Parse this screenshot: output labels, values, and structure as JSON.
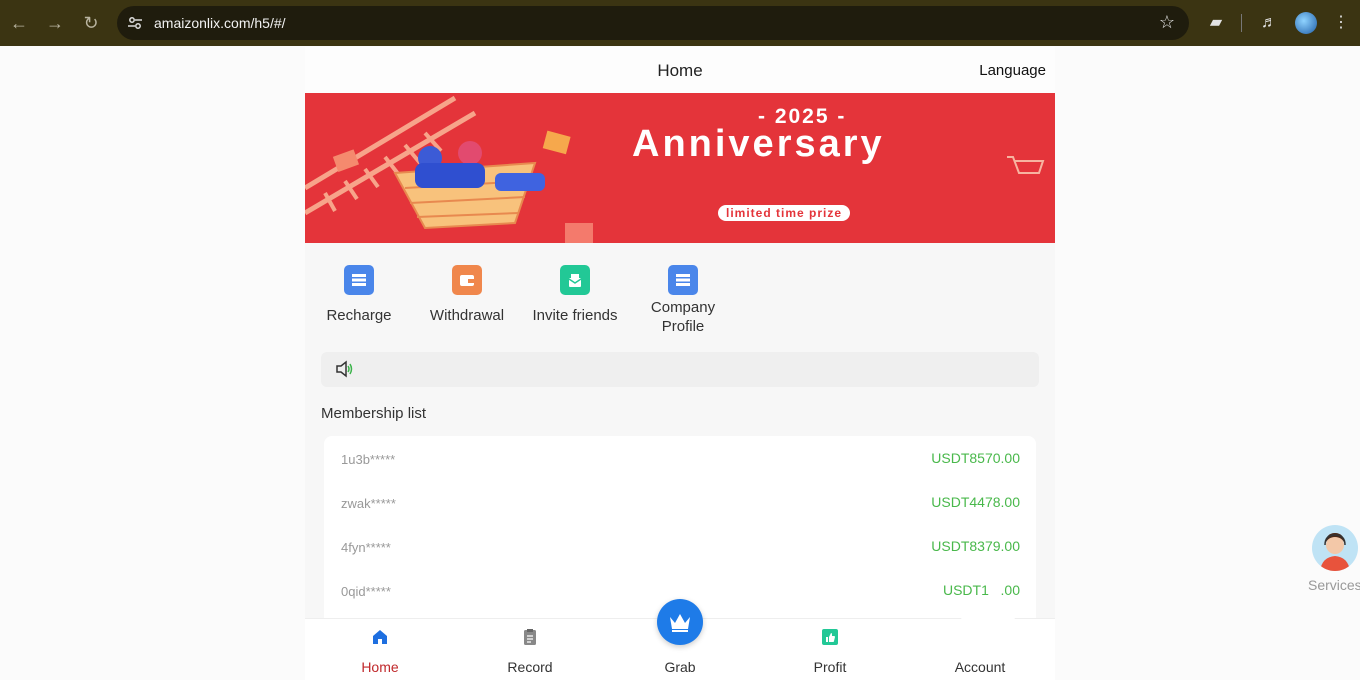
{
  "browser": {
    "url": "amaizonlix.com/h5/#/"
  },
  "header": {
    "title": "Home",
    "language": "Language"
  },
  "banner": {
    "year": "- 2025 -",
    "headline": "Anniversary",
    "tagline": "limited time prize"
  },
  "quick_actions": [
    {
      "label": "Recharge",
      "icon": "wallet-card-icon",
      "color": "#4a86ea"
    },
    {
      "label": "Withdrawal",
      "icon": "wallet-icon",
      "color": "#f0874c"
    },
    {
      "label": "Invite friends",
      "icon": "invite-icon",
      "color": "#22c896"
    },
    {
      "label": "Company Profile",
      "icon": "document-icon",
      "color": "#4a86ea"
    }
  ],
  "membership": {
    "title": "Membership list",
    "rows": [
      {
        "name": "1u3b*****",
        "amount": "USDT8570.00"
      },
      {
        "name": "zwak*****",
        "amount": "USDT4478.00"
      },
      {
        "name": "4fyn*****",
        "amount": "USDT8379.00"
      },
      {
        "name": "0qid*****",
        "amount": "USDT1   .00"
      }
    ]
  },
  "tabs": [
    {
      "label": "Home",
      "icon": "home-icon"
    },
    {
      "label": "Record",
      "icon": "clipboard-icon"
    },
    {
      "label": "Grab",
      "icon": "crown-icon"
    },
    {
      "label": "Profit",
      "icon": "thumbs-up-icon"
    },
    {
      "label": "Account",
      "icon": "user-icon"
    }
  ],
  "services": {
    "label": "Services"
  },
  "colors": {
    "accent_red": "#c0282b",
    "amount_green": "#49b84b",
    "banner_red": "#e4343a",
    "grab_blue": "#1e7be8"
  }
}
